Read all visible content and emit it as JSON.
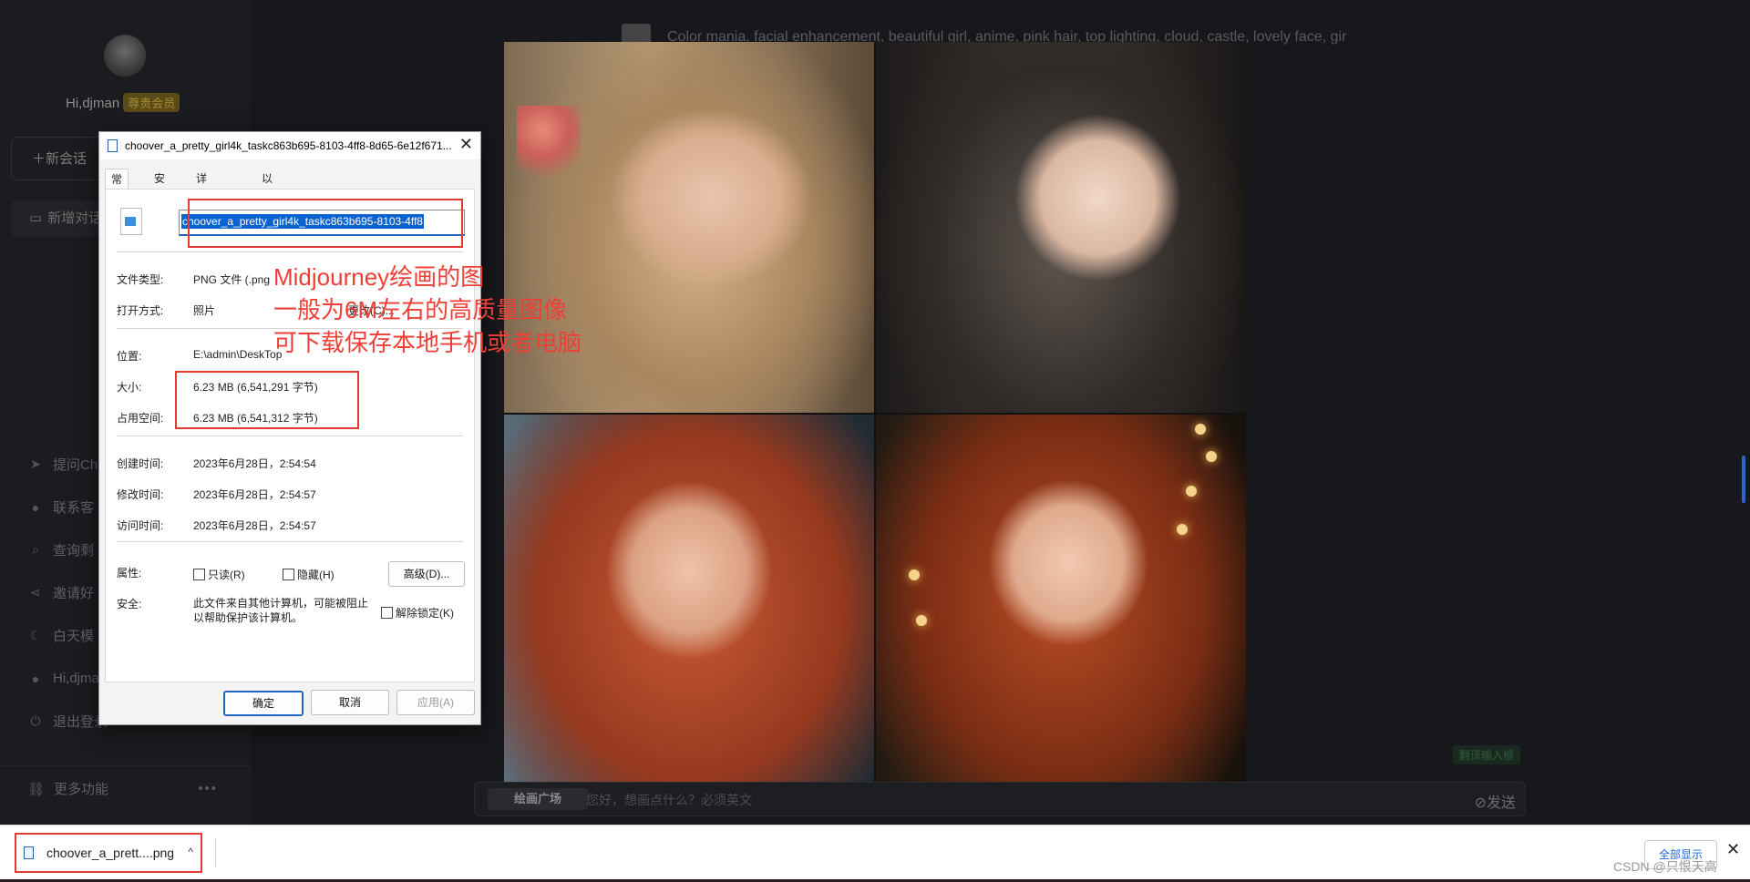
{
  "sidebar": {
    "greeting": "Hi,djman",
    "vip_badge": "尊贵会员",
    "new_chat_label": "＋新会话",
    "add_conversation_label": "新增对话",
    "menu": [
      {
        "icon": "send-icon",
        "label": "提问Ch"
      },
      {
        "icon": "wechat-icon",
        "label": "联系客"
      },
      {
        "icon": "search-icon",
        "label": "查询剩"
      },
      {
        "icon": "share-icon",
        "label": "邀请好"
      },
      {
        "icon": "moon-icon",
        "label": "白天模"
      },
      {
        "icon": "user-icon",
        "label": "Hi,djma"
      },
      {
        "icon": "power-icon",
        "label": "退出登录"
      }
    ],
    "more_label": "更多功能",
    "more_dots": "•••"
  },
  "main": {
    "prompt_text": "Color mania, facial enhancement, beautiful girl, anime, pink hair, top lighting, cloud, castle, lovely face, gir",
    "translate_label": "翻译输入框",
    "chat_tab_label": "绘画广场",
    "chat_placeholder": "您好，想画点什么？必须英文",
    "send_label": "发送"
  },
  "dialog": {
    "title": "choover_a_pretty_girl4k_taskc863b695-8103-4ff8-8d65-6e12f671...",
    "close_glyph": "✕",
    "tabs": [
      "常规",
      "安全",
      "详细信息",
      "以前的版本"
    ],
    "filename": "choover_a_pretty_girl4k_taskc863b695-8103-4ff8",
    "file_type_label": "文件类型:",
    "file_type_value": "PNG 文件 (.png",
    "open_with_label": "打开方式:",
    "open_with_value": "照片",
    "change_button": "更改(C)...",
    "location_label": "位置:",
    "location_value": "E:\\admin\\DeskTop",
    "size_label": "大小:",
    "size_value": "6.23 MB (6,541,291 字节)",
    "disk_size_label": "占用空间:",
    "disk_size_value": "6.23 MB (6,541,312 字节)",
    "created_label": "创建时间:",
    "created_value": "2023年6月28日，2:54:54",
    "modified_label": "修改时间:",
    "modified_value": "2023年6月28日，2:54:57",
    "accessed_label": "访问时间:",
    "accessed_value": "2023年6月28日，2:54:57",
    "attributes_label": "属性:",
    "readonly_label": "只读(R)",
    "hidden_label": "隐藏(H)",
    "advanced_button": "高级(D)...",
    "security_label": "安全:",
    "security_text": "此文件来自其他计算机，可能被阻止以帮助保护该计算机。",
    "unblock_label": "解除锁定(K)",
    "ok_button": "确定",
    "cancel_button": "取消",
    "apply_button": "应用(A)"
  },
  "annotation": {
    "lines": [
      "Midjourney绘画的图",
      "一般为6M左右的高质量图像",
      "可下载保存本地手机或者电脑"
    ],
    "color": "#ee3f37"
  },
  "download_bar": {
    "file_label": "choover_a_prett....png",
    "chevron": "^",
    "show_all": "全部显示",
    "close_glyph": "✕"
  },
  "watermark": "CSDN @只恨天高"
}
